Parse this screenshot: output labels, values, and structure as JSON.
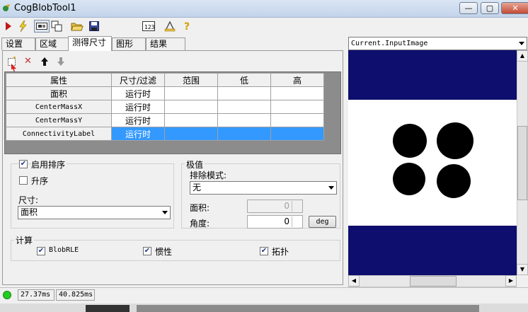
{
  "window": {
    "title": "CogBlobTool1",
    "min_glyph": "—",
    "max_glyph": "▢",
    "close_glyph": "✕"
  },
  "tabs": [
    "设置",
    "区域",
    "测得尺寸",
    "图形",
    "结果"
  ],
  "active_tab": "测得尺寸",
  "grid": {
    "headers": [
      "属性",
      "尺寸/过滤",
      "范围",
      "低",
      "高"
    ],
    "rows": [
      {
        "property": "面积",
        "filter": "运行时",
        "range": "",
        "low": "",
        "high": ""
      },
      {
        "property": "CenterMassX",
        "filter": "运行时",
        "range": "",
        "low": "",
        "high": ""
      },
      {
        "property": "CenterMassY",
        "filter": "运行时",
        "range": "",
        "low": "",
        "high": ""
      },
      {
        "property": "ConnectivityLabel",
        "filter": "运行时",
        "range": "",
        "low": "",
        "high": "",
        "selected": true
      }
    ]
  },
  "sort": {
    "enable_label": "启用排序",
    "enable_checked": true,
    "ascending_label": "升序",
    "ascending_checked": false,
    "size_label": "尺寸:",
    "size_value": "面积"
  },
  "extremes": {
    "title": "极值",
    "exclude_mode_label": "排除模式:",
    "exclude_mode_value": "无",
    "area_label": "面积:",
    "area_value": "0",
    "angle_label": "角度:",
    "angle_value": "0",
    "deg_button": "deg"
  },
  "compute": {
    "title": "计算",
    "items": [
      {
        "label": "BlobRLE",
        "checked": true
      },
      {
        "label": "惯性",
        "checked": true
      },
      {
        "label": "拓扑",
        "checked": true
      }
    ]
  },
  "status": {
    "time1": "27.37ms",
    "time2": "40.825ms",
    "ok_color": "#22cc22"
  },
  "display": {
    "image_select": "Current.InputImage",
    "band_color": "#0e0e6e"
  }
}
